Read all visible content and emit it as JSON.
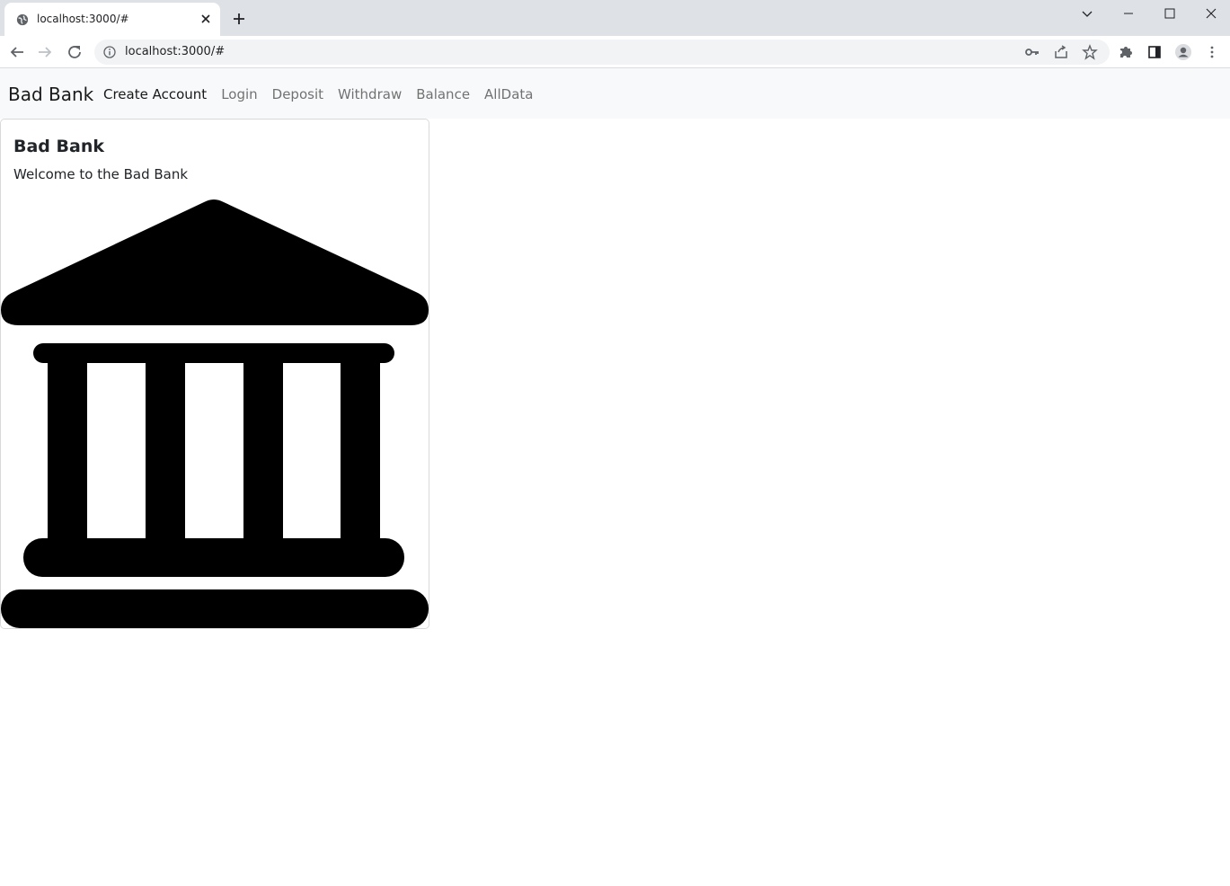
{
  "browser": {
    "tab_title": "localhost:3000/#",
    "url": "localhost:3000/#"
  },
  "navbar": {
    "brand": "Bad Bank",
    "links": [
      {
        "label": "Create Account",
        "active": true
      },
      {
        "label": "Login",
        "active": false
      },
      {
        "label": "Deposit",
        "active": false
      },
      {
        "label": "Withdraw",
        "active": false
      },
      {
        "label": "Balance",
        "active": false
      },
      {
        "label": "AllData",
        "active": false
      }
    ]
  },
  "card": {
    "title": "Bad Bank",
    "text": "Welcome to the Bad Bank",
    "image_icon": "bank-icon"
  },
  "colors": {
    "tabstrip": "#dee1e6",
    "navbar_bg": "#f8f9fa",
    "icon": "#000000"
  }
}
